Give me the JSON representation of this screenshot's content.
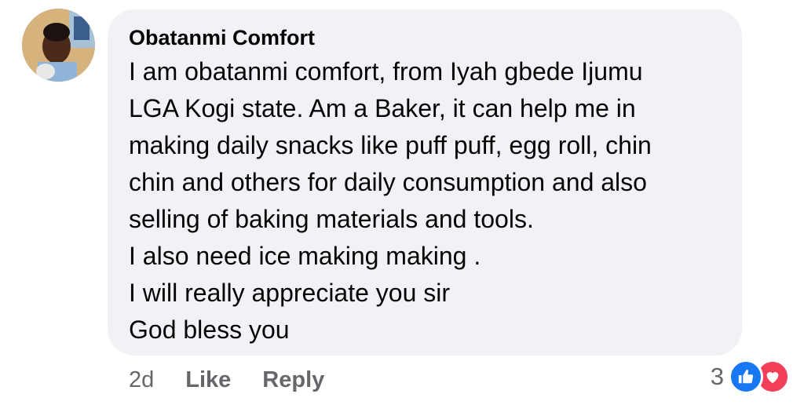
{
  "comment": {
    "author": "Obatanmi Comfort",
    "lines": [
      "I am obatanmi comfort, from Iyah gbede Ijumu",
      "LGA Kogi state. Am a Baker, it can help me in",
      "making daily snacks like puff puff, egg roll, chin",
      "chin and others for daily consumption and also",
      "selling of baking materials and tools.",
      "I also need ice making making .",
      "I will really appreciate you sir",
      "God bless you"
    ]
  },
  "actions": {
    "age": "2d",
    "like_label": "Like",
    "reply_label": "Reply"
  },
  "reactions": {
    "count": "3",
    "types": [
      "like-icon",
      "love-icon"
    ],
    "like_color": "#1877f2",
    "love_color": "#f33e58"
  },
  "colors": {
    "bubble_bg": "#f0f2f5",
    "text": "#050505",
    "secondary_text": "#65676b"
  }
}
